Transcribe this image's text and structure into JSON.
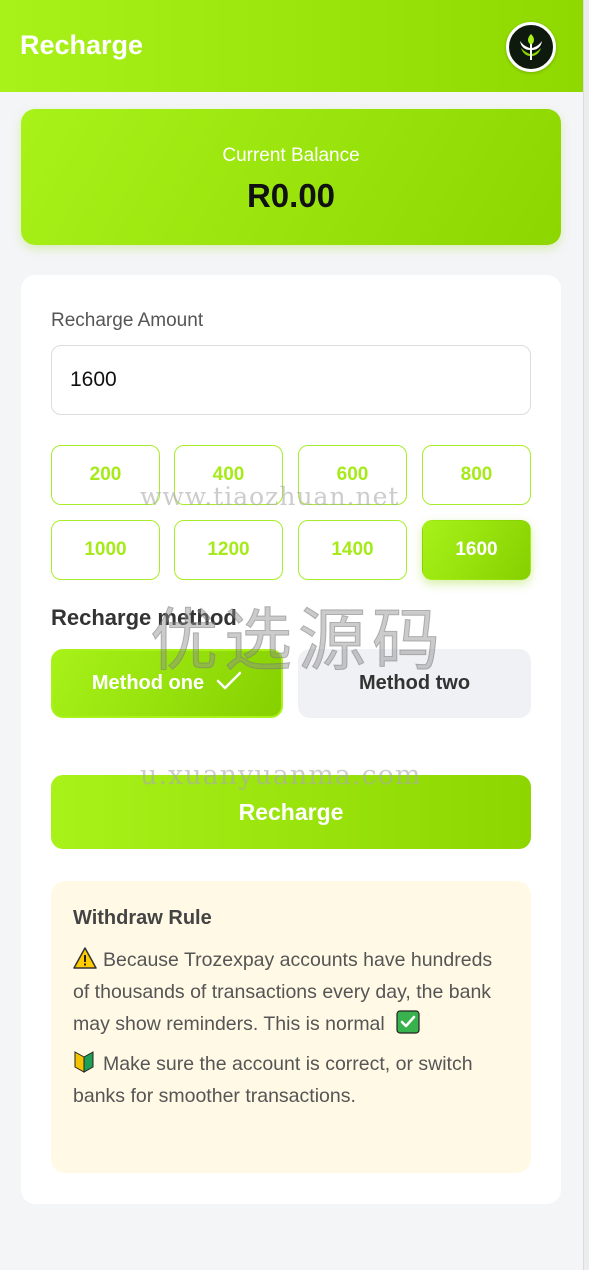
{
  "header": {
    "title": "Recharge",
    "logo_icon": "leaf-logo-icon"
  },
  "balance": {
    "label": "Current Balance",
    "amount": "R0.00"
  },
  "recharge_amount": {
    "label": "Recharge Amount",
    "input_value": "1600",
    "options": [
      "200",
      "400",
      "600",
      "800",
      "1000",
      "1200",
      "1400",
      "1600"
    ],
    "selected": "1600"
  },
  "method": {
    "label": "Recharge method",
    "options": [
      "Method one",
      "Method two"
    ],
    "selected": "Method one"
  },
  "recharge_button": "Recharge",
  "rule": {
    "title": "Withdraw Rule",
    "lines": [
      "Because Trozexpay accounts have hundreds of thousands of transactions every day, the bank may show reminders. This is normal",
      "Make sure the account is correct, or switch banks for smoother transactions."
    ]
  },
  "watermark": {
    "url": "www.tiaozhuan.net",
    "text": "优选源码",
    "site": "u.xuanyuanma.com"
  },
  "colors": {
    "accent": "#a8f21a",
    "accent_dark": "#8dd600",
    "rule_bg": "#fff9e6"
  }
}
